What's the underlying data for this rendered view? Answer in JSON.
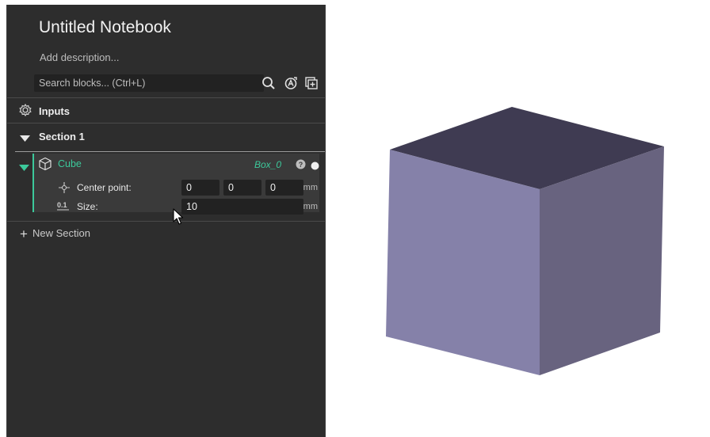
{
  "notebook": {
    "title": "Untitled Notebook",
    "description_placeholder": "Add description..."
  },
  "search": {
    "placeholder": "Search blocks... (Ctrl+L)"
  },
  "inputs": {
    "label": "Inputs"
  },
  "section": {
    "label": "Section 1"
  },
  "block": {
    "name": "Cube",
    "variable": "Box_0",
    "params": [
      {
        "label": "Center point:",
        "values": [
          "0",
          "0",
          "0"
        ],
        "unit": "mm"
      },
      {
        "label": "Size:",
        "values": [
          "10"
        ],
        "unit": "mm"
      }
    ]
  },
  "new_section": {
    "label": "New Section"
  },
  "icons": {
    "search": "search-icon",
    "ai": "ai-assistant-icon",
    "add_block": "add-block-icon",
    "inputs": "gear-icon",
    "block": "cube-icon",
    "help": "help-icon",
    "status": "status-dot-icon",
    "center_point": "crosshair-icon",
    "size": "decimal-number-icon"
  },
  "colors": {
    "panel": "#2d2d2d",
    "accent": "#3cc99b",
    "cube_top": "#3f3b52",
    "cube_left": "#8581a9",
    "cube_right": "#68637f"
  }
}
